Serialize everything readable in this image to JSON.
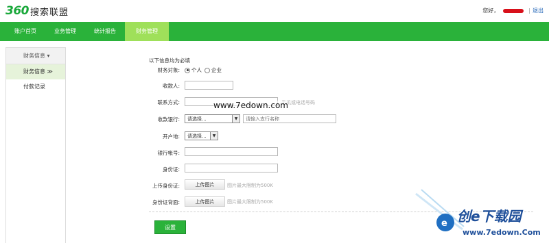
{
  "header": {
    "logo_mark": "360",
    "logo_text": "搜索联盟",
    "greeting": "您好，",
    "separator": "|",
    "logout_label": "退出"
  },
  "nav": {
    "items": [
      {
        "label": "账户首页"
      },
      {
        "label": "业务管理"
      },
      {
        "label": "统计报告"
      },
      {
        "label": "财务管理"
      }
    ]
  },
  "sidebar": {
    "section_label": "财务信息 ▾",
    "items": [
      {
        "label": "财务信息 ≫"
      },
      {
        "label": "付款记录"
      }
    ]
  },
  "form": {
    "notice": "以下信息均为必填",
    "target_label": "财务对象:",
    "target_options": [
      "个人",
      "企业"
    ],
    "payee_label": "收款人:",
    "payee_value": "",
    "contact_label": "联系方式:",
    "contact_value": "",
    "contact_hint": "手机或电话号码",
    "bank_label": "收款银行:",
    "bank_select": "请选择...",
    "branch_placeholder": "请输入支行名称",
    "location_label": "开户地:",
    "location_select": "请选择...",
    "account_label": "银行帐号:",
    "account_value": "",
    "idcard_label": "身份证:",
    "idcard_value": "",
    "upload_front_label": "上传身份证:",
    "upload_back_label": "身份证背面:",
    "upload_button": "上传图片",
    "upload_hint": "图片最大限制为500K",
    "submit_label": "设置"
  },
  "watermarks": {
    "center": "www.7edown.com",
    "corner_title": "创e下载园",
    "corner_url": "www.7edown.Com"
  },
  "colors": {
    "brand_green": "#2ab23a",
    "nav_active": "#9fe05a",
    "link_blue": "#1a5fb4",
    "redaction_red": "#d8101a"
  }
}
